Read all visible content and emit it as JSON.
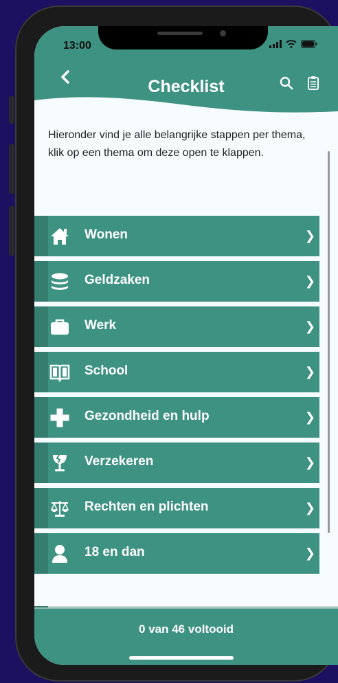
{
  "status_bar": {
    "time": "13:00"
  },
  "header": {
    "title": "Checklist"
  },
  "intro": "Hieronder vind je alle belangrijke stappen per thema, klik op een thema om deze open te klappen.",
  "themes": [
    {
      "label": "Wonen",
      "icon": "home-icon"
    },
    {
      "label": "Geldzaken",
      "icon": "coins-icon"
    },
    {
      "label": "Werk",
      "icon": "briefcase-icon"
    },
    {
      "label": "School",
      "icon": "book-icon"
    },
    {
      "label": "Gezondheid en hulp",
      "icon": "medical-cross-icon"
    },
    {
      "label": "Verzekeren",
      "icon": "fragile-glass-icon"
    },
    {
      "label": "Rechten en plichten",
      "icon": "scales-icon"
    },
    {
      "label": "18 en dan",
      "icon": "person-icon"
    }
  ],
  "footer": {
    "progress": "0 van 46 voltooid"
  },
  "colors": {
    "accent": "#3e9282",
    "accent_dark": "#357d6f",
    "background": "#1c1060"
  }
}
